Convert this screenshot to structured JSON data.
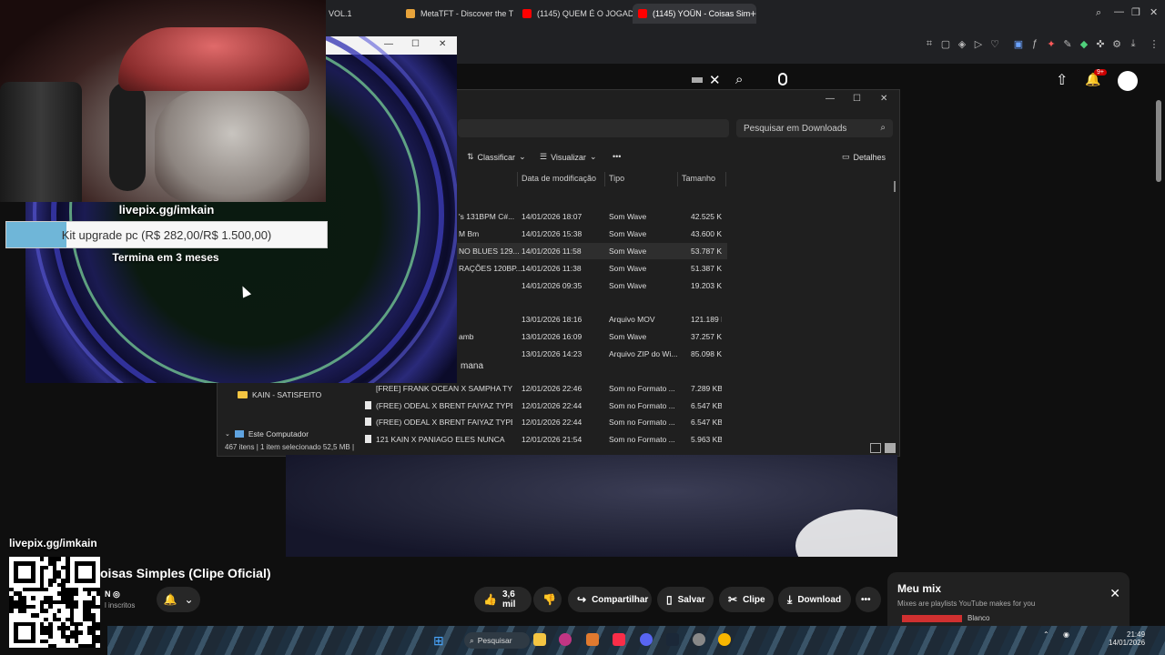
{
  "browser": {
    "tabs": [
      {
        "label": "VOL.1",
        "icon_color": "#5e5e5e"
      },
      {
        "label": "MetaTFT - Discover the T",
        "icon_color": "#e7a33b"
      },
      {
        "label": "(1145) QUEM É O JOGADO",
        "icon_color": "#ff0000"
      },
      {
        "label": "(1145) YOÜN - Coisas Sim",
        "icon_color": "#ff0000"
      }
    ],
    "new_tab": "+",
    "notifications_badge": "9+"
  },
  "overlay": {
    "livepix_title": "livepix.gg/imkain",
    "goal_label": "Kit upgrade pc (R$ 282,00/R$ 1.500,00)",
    "goal_progress": 0.188,
    "goal_ends": "Termina em 3 meses"
  },
  "explorer": {
    "search_placeholder": "Pesquisar em Downloads",
    "commands": {
      "sort": "Classificar",
      "view": "Visualizar",
      "more": "•••",
      "details": "Detalhes"
    },
    "columns": [
      "Data de modificação",
      "Tipo",
      "Tamanho"
    ],
    "rows": [
      {
        "name": "'s 131BPM C#...",
        "date": "14/01/2026 18:07",
        "type": "Som Wave",
        "size": "42.525 KB",
        "selected": false,
        "show_icon": false
      },
      {
        "name": "M Bm",
        "date": "14/01/2026 15:38",
        "type": "Som Wave",
        "size": "43.600 KB",
        "selected": false,
        "show_icon": false
      },
      {
        "name": "NO BLUES 129...",
        "date": "14/01/2026 11:58",
        "type": "Som Wave",
        "size": "53.787 KB",
        "selected": true,
        "show_icon": false
      },
      {
        "name": "RAÇÕES 120BP...",
        "date": "14/01/2026 11:38",
        "type": "Som Wave",
        "size": "51.387 KB",
        "selected": false,
        "show_icon": false
      },
      {
        "name": "",
        "date": "14/01/2026 09:35",
        "type": "Som Wave",
        "size": "19.203 KB",
        "selected": false,
        "show_icon": false
      },
      {
        "name": "",
        "date": "13/01/2026 18:16",
        "type": "Arquivo MOV",
        "size": "121.189 KB",
        "selected": false,
        "show_icon": false
      },
      {
        "name": "amb",
        "date": "13/01/2026 16:09",
        "type": "Som Wave",
        "size": "37.257 KB",
        "selected": false,
        "show_icon": false
      },
      {
        "name": "",
        "date": "13/01/2026 14:23",
        "type": "Arquivo ZIP do Wi...",
        "size": "85.098 KB",
        "selected": false,
        "show_icon": false
      },
      {
        "name": "[FREE] FRANK OCEAN X SAMPHA TYPE ...",
        "date": "12/01/2026 22:46",
        "type": "Som no Formato ...",
        "size": "7.289 KB",
        "selected": false,
        "show_icon": false
      },
      {
        "name": "(FREE) ODEAL X BRENT FAIYAZ TYPE BEA...",
        "date": "12/01/2026 22:44",
        "type": "Som no Formato ...",
        "size": "6.547 KB",
        "selected": false,
        "show_icon": true
      },
      {
        "name": "(FREE) ODEAL X BRENT FAIYAZ TYPE BEA...",
        "date": "12/01/2026 22:44",
        "type": "Som no Formato ...",
        "size": "6.547 KB",
        "selected": false,
        "show_icon": true
      },
      {
        "name": "121 KAIN X PANIAGO ELES NUNCA",
        "date": "12/01/2026 21:54",
        "type": "Som no Formato ...",
        "size": "5.963 KB",
        "selected": false,
        "show_icon": true
      }
    ],
    "group_week": "mana",
    "nav": {
      "folder": "KAIN - SATISFEITO",
      "computer": "Este Computador"
    },
    "status": "467 itens  |  1 item selecionado  52,5 MB  |"
  },
  "youtube": {
    "title": "oisas Simples (Clipe Oficial)",
    "channel": "N",
    "subs": "l inscritos",
    "like_count": "3,6 mil",
    "share": "Compartilhar",
    "save": "Salvar",
    "clip": "Clipe",
    "download": "Download",
    "more": "•••"
  },
  "mix": {
    "title": "Meu mix",
    "subtitle": "Mixes are playlists YouTube makes for you",
    "next_item": "Blanco"
  },
  "qr": {
    "label": "livepix.gg/imkain"
  },
  "taskbar": {
    "search": "Pesquisar",
    "time": "21:49",
    "date": "14/01/2026"
  }
}
